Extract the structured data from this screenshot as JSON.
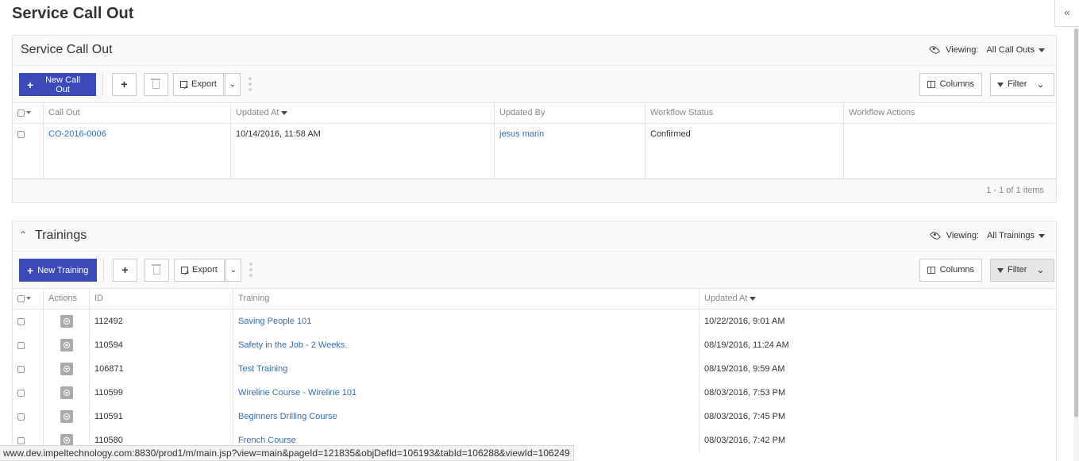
{
  "page_title": "Service Call Out",
  "collapse_glyph": "«",
  "viewing_label": "Viewing:",
  "service_panel": {
    "title": "Service Call Out",
    "view_name": "All Call Outs",
    "new_label": "New Call Out",
    "export_label": "Export",
    "columns_label": "Columns",
    "filter_label": "Filter",
    "headers": [
      "Call Out",
      "Updated At",
      "Updated By",
      "Workflow Status",
      "Workflow Actions"
    ],
    "rows": [
      {
        "call_out": "CO-2016-0006",
        "updated_at": "10/14/2016, 11:58 AM",
        "updated_by": "jesus marin",
        "status": "Confirmed",
        "actions": ""
      }
    ],
    "count_text": "1 - 1 of 1 items"
  },
  "training_panel": {
    "title": "Trainings",
    "view_name": "All Trainings",
    "new_label": "New Training",
    "export_label": "Export",
    "columns_label": "Columns",
    "filter_label": "Filter",
    "headers": [
      "Actions",
      "ID",
      "Training",
      "Updated At"
    ],
    "rows": [
      {
        "id": "112492",
        "training": "Saving People 101",
        "updated_at": "10/22/2016, 9:01 AM"
      },
      {
        "id": "110594",
        "training": "Safety in the Job - 2 Weeks.",
        "updated_at": "08/19/2016, 11:24 AM"
      },
      {
        "id": "106871",
        "training": "Test Training",
        "updated_at": "08/19/2016, 9:59 AM"
      },
      {
        "id": "110599",
        "training": "Wireline Course - Wireline 101",
        "updated_at": "08/03/2016, 7:53 PM"
      },
      {
        "id": "110591",
        "training": "Beginners Drilling Course",
        "updated_at": "08/03/2016, 7:45 PM"
      },
      {
        "id": "110580",
        "training": "French Course",
        "updated_at": "08/03/2016, 7:42 PM"
      }
    ]
  },
  "status_url": "www.dev.impeltechnology.com:8830/prod1/m/main.jsp?view=main&pageId=121835&objDefId=106193&tabId=106288&viewId=106249"
}
